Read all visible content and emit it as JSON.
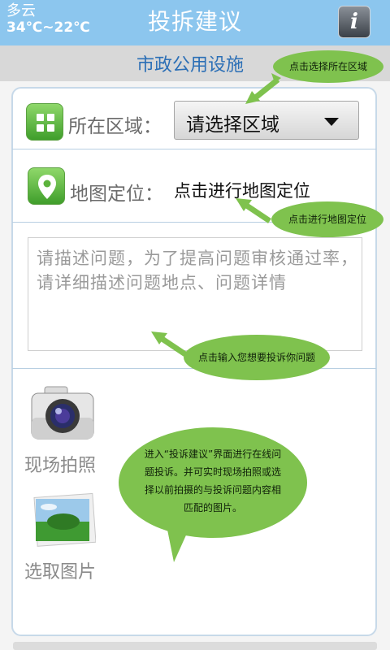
{
  "status": {
    "weather": "多云",
    "temperature": "34℃~22℃"
  },
  "header": {
    "title": "投拆建议",
    "info_label": "i"
  },
  "category": "市政公用设施",
  "area": {
    "label": "所在区域：",
    "select_value": "请选择区域"
  },
  "map": {
    "label": "地图定位：",
    "action": "点击进行地图定位"
  },
  "description": {
    "placeholder": "请描述问题，为了提高问题审核通过率，请详细描述问题地点、问题详情"
  },
  "tools": {
    "camera_label": "现场拍照",
    "gallery_label": "选取图片"
  },
  "tips": {
    "area_tip": "点击选择所在区域",
    "map_tip": "点击进行地图定位",
    "input_tip": "点击输入您想要投诉你问题",
    "intro_tip": "进入“投诉建议”界面进行在线问题投诉。并可实时现场拍照或选择以前拍摄的与投诉问题内容相匹配的图片。"
  },
  "colors": {
    "header": "#8cc6ee",
    "accent": "#2c6fb6",
    "bubble": "#7fc24e"
  },
  "icons": [
    "grid-icon",
    "location-pin-icon",
    "camera-icon",
    "landscape-photo-icon",
    "info-icon",
    "dropdown-arrow-icon"
  ]
}
